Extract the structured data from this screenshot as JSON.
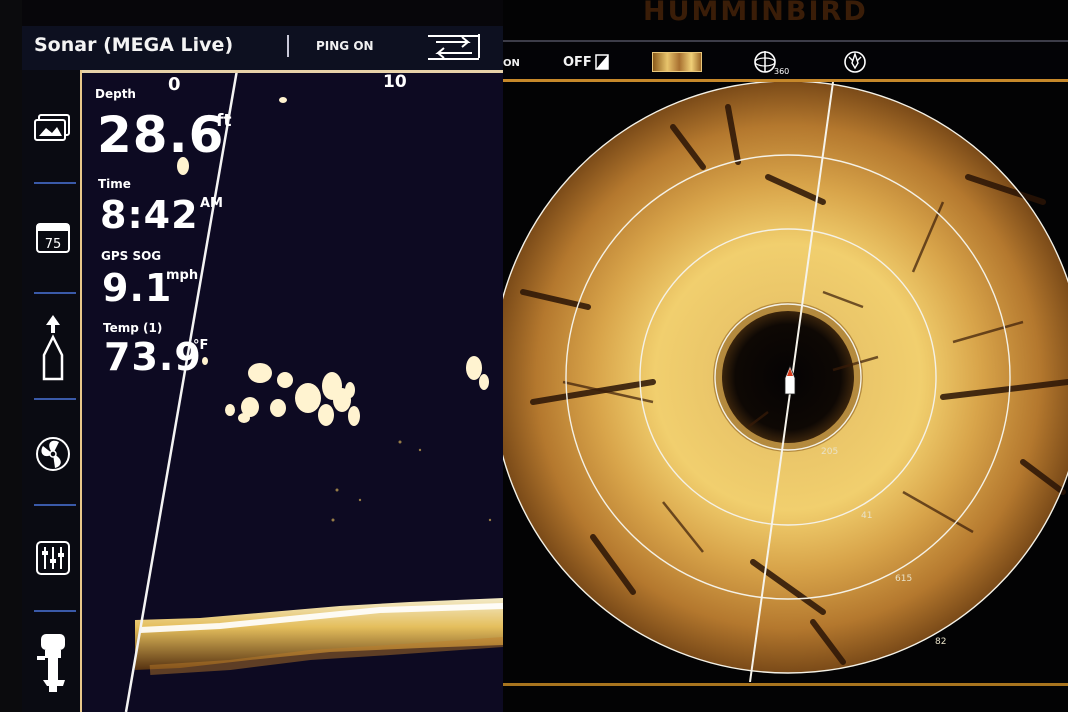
{
  "left_screen": {
    "title": "Sonar (MEGA Live)",
    "ping_status": "PING ON",
    "scale_labels": [
      "0",
      "10"
    ],
    "readouts": {
      "depth": {
        "label": "Depth",
        "value": "28.6",
        "unit": "ft"
      },
      "time": {
        "label": "Time",
        "value": "8:42",
        "unit": "AM"
      },
      "gps_sog": {
        "label": "GPS SOG",
        "value": "9.1",
        "unit": "mph"
      },
      "temp": {
        "label": "Temp (1)",
        "value": "73.9",
        "unit": "°F"
      }
    },
    "sidebar": {
      "items": [
        {
          "name": "views-icon"
        },
        {
          "name": "calendar-icon",
          "text": "75"
        },
        {
          "name": "boat-heading-icon"
        },
        {
          "name": "propeller-icon"
        },
        {
          "name": "settings-sliders-icon"
        },
        {
          "name": "outboard-motor-icon"
        }
      ]
    }
  },
  "right_screen": {
    "brand": "HUMMINBIRD",
    "toolbar": {
      "ping_cut": "ON",
      "off_label": "OFF",
      "rotate_label": "360"
    },
    "range_rings": [
      "205",
      "41",
      "615",
      "82"
    ]
  },
  "colors": {
    "sonar_gold": "#e8b64a",
    "sonar_background": "#0d0a22",
    "accent_orange": "#c6882a",
    "sidebar_separator": "#3a5aa8"
  }
}
